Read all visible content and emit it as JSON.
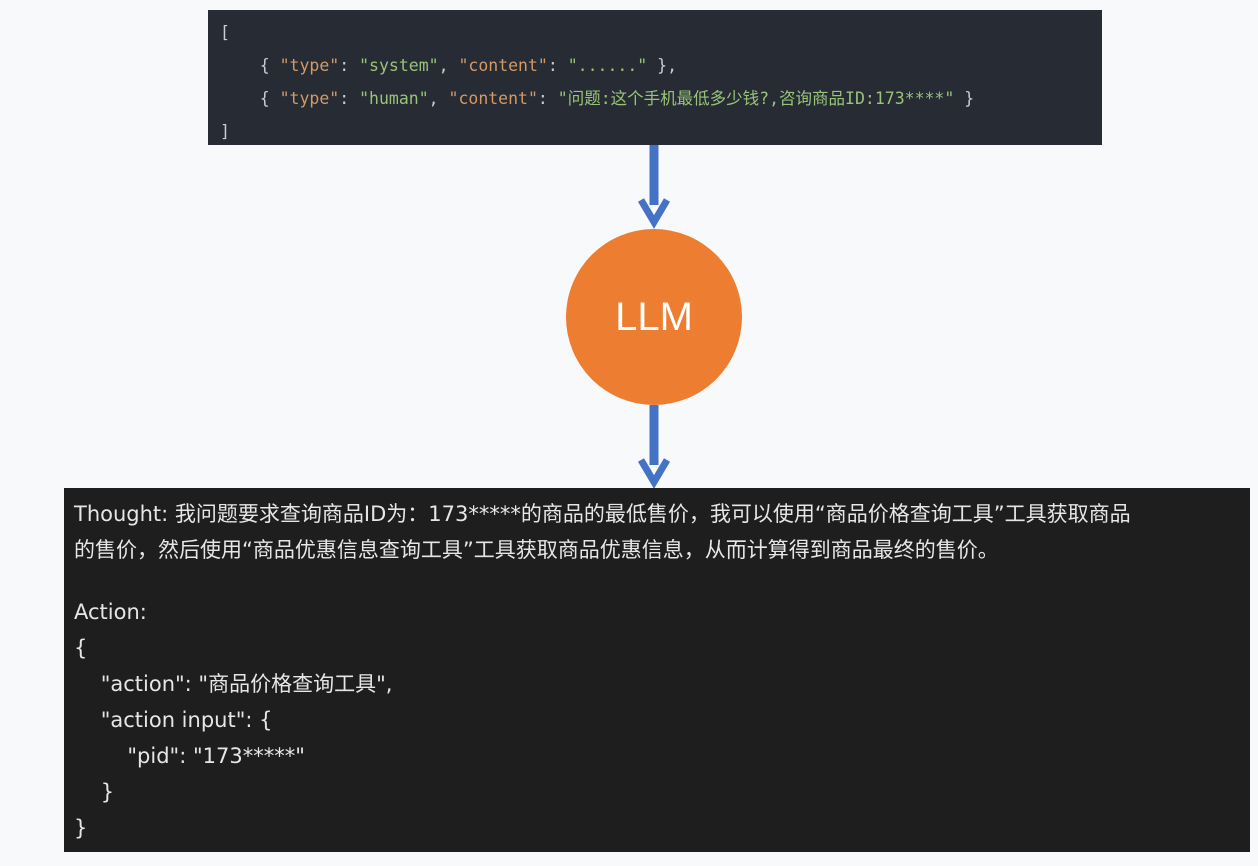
{
  "input_messages": {
    "open": "[",
    "close": "]",
    "messages": [
      {
        "type_key": "\"type\"",
        "type_value": "\"system\"",
        "content_key": "\"content\"",
        "content_value": "\"......\""
      },
      {
        "type_key": "\"type\"",
        "type_value": "\"human\"",
        "content_key": "\"content\"",
        "content_value": "\"问题:这个手机最低多少钱?,咨询商品ID:173****\""
      }
    ]
  },
  "llm": {
    "label": "LLM",
    "color": "#ed7d31"
  },
  "arrow_color": "#4472c4",
  "output": {
    "thought_line1": "Thought: 我问题要求查询商品ID为：173*****的商品的最低售价，我可以使用“商品价格查询工具”工具获取商品",
    "thought_line2": "的售价，然后使用“商品优惠信息查询工具”工具获取商品优惠信息，从而计算得到商品最终的售价。",
    "action_label": "Action:",
    "json_lines": [
      "{",
      "    \"action\": \"商品价格查询工具\",",
      "    \"action input\": {",
      "        \"pid\": \"173*****\"",
      "    }",
      "}"
    ]
  }
}
